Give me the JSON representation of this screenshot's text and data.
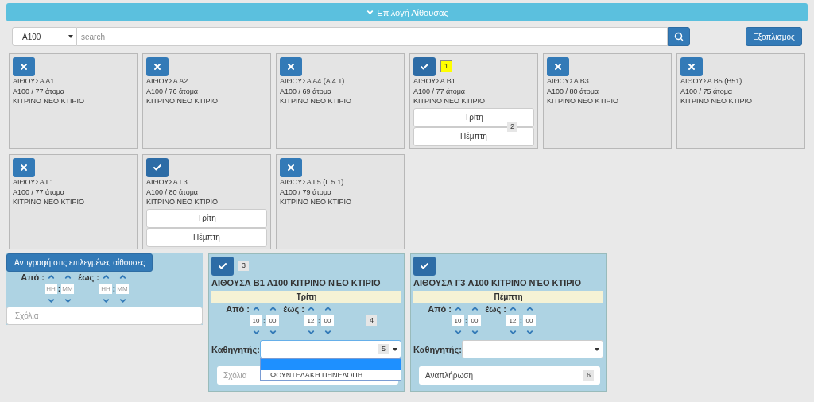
{
  "header": {
    "label": "Επιλογή Αίθουσας"
  },
  "toolbar": {
    "building_select": {
      "value": "A100"
    },
    "search": {
      "placeholder": "search"
    },
    "equipment_button": "Εξοπλισμός"
  },
  "rooms": [
    {
      "name": "ΑΙΘΟΥΣΑ Α1",
      "capacity": "A100 / 77 άτομα",
      "building": "ΚΙΤΡΙΝΟ ΝΕΟ ΚΤΙΡΙΟ",
      "selected": false
    },
    {
      "name": "ΑΙΘΟΥΣΑ Α2",
      "capacity": "A100 / 76 άτομα",
      "building": "ΚΙΤΡΙΝΟ ΝΕΟ ΚΤΙΡΙΟ",
      "selected": false
    },
    {
      "name": "ΑΙΘΟΥΣΑ Α4 (Α 4.1)",
      "capacity": "A100 / 69 άτομα",
      "building": "ΚΙΤΡΙΝΟ ΝΕΟ ΚΤΙΡΙΟ",
      "selected": false
    },
    {
      "name": "ΑΙΘΟΥΣΑ Β1",
      "capacity": "A100 / 77 άτομα",
      "building": "ΚΙΤΡΙΝΟ ΝΕΟ ΚΤΙΡΙΟ",
      "selected": true,
      "badge": {
        "text": "1",
        "color": "#ffff00"
      },
      "days": [
        "Τρίτη",
        "Πέμπτη"
      ],
      "days_badge": {
        "text": "2",
        "color": "#e6e6e6"
      }
    },
    {
      "name": "ΑΙΘΟΥΣΑ Β3",
      "capacity": "A100 / 80 άτομα",
      "building": "ΚΙΤΡΙΝΟ ΝΕΟ ΚΤΙΡΙΟ",
      "selected": false
    },
    {
      "name": "ΑΙΘΟΥΣΑ Β5 (Β51)",
      "capacity": "A100 / 75 άτομα",
      "building": "ΚΙΤΡΙΝΟ ΝΕΟ ΚΤΙΡΙΟ",
      "selected": false
    },
    {
      "name": "ΑΙΘΟΥΣΑ Γ1",
      "capacity": "A100 / 77 άτομα",
      "building": "ΚΙΤΡΙΝΟ ΝΕΟ ΚΤΙΡΙΟ",
      "selected": false
    },
    {
      "name": "ΑΙΘΟΥΣΑ Γ3",
      "capacity": "A100 / 80 άτομα",
      "building": "ΚΙΤΡΙΝΟ ΝΕΟ ΚΤΙΡΙΟ",
      "selected": true,
      "days": [
        "Τρίτη",
        "Πέμπτη"
      ]
    },
    {
      "name": "ΑΙΘΟΥΣΑ Γ5 (Γ 5.1)",
      "capacity": "A100 / 79 άτομα",
      "building": "ΚΙΤΡΙΝΟ ΝΕΟ ΚΤΙΡΙΟ",
      "selected": false
    }
  ],
  "copy_panel": {
    "button": "Αντιγραφή στις επιλεγμένες αίθουσες",
    "from_label": "Από :",
    "to_label": "έως :",
    "separator": ":",
    "from_hour": {
      "placeholder": "HH"
    },
    "from_minute": {
      "placeholder": "MM"
    },
    "to_hour": {
      "placeholder": "HH"
    },
    "to_minute": {
      "placeholder": "MM"
    },
    "comments": {
      "placeholder": "Σχόλια"
    }
  },
  "schedules": [
    {
      "selected": true,
      "badge": {
        "text": "3",
        "color": "#e6e6e6"
      },
      "title": "ΑΙΘΟΥΣΑ Β1 A100 ΚΙΤΡΙΝΟ ΝΈΟ ΚΤΙΡΙΟ",
      "day": "Τρίτη",
      "from_label": "Από :",
      "to_label": "έως :",
      "separator": ":",
      "from_hour": {
        "value": "10"
      },
      "from_minute": {
        "value": "00"
      },
      "to_hour": {
        "value": "12"
      },
      "to_minute": {
        "value": "00"
      },
      "time_badge": {
        "text": "4",
        "color": "#e6e6e6"
      },
      "teacher_label": "Καθηγητής:",
      "teacher_select": {
        "open": true,
        "badge": {
          "text": "5",
          "color": "#e6e6e6"
        },
        "options": [
          {
            "kind": "blank",
            "selected": true
          },
          {
            "kind": "text",
            "label": "ΦΟΥΝΤΕΔΑΚΗ ΠΗΝΕΛΟΠΗ",
            "selected": false
          }
        ]
      },
      "comments": {
        "placeholder": "Σχόλια"
      }
    },
    {
      "selected": true,
      "title": "ΑΙΘΟΥΣΑ Γ3 A100 ΚΙΤΡΙΝΟ ΝΈΟ ΚΤΙΡΙΟ",
      "day": "Πέμπτη",
      "from_label": "Από :",
      "to_label": "έως :",
      "separator": ":",
      "from_hour": {
        "value": "10"
      },
      "from_minute": {
        "value": "00"
      },
      "to_hour": {
        "value": "12"
      },
      "to_minute": {
        "value": "00"
      },
      "teacher_label": "Καθηγητής:",
      "teacher_select": {
        "open": false
      },
      "comments": {
        "value": "Αναπλήρωση",
        "badge": {
          "text": "6",
          "color": "#e6e6e6"
        }
      }
    }
  ]
}
